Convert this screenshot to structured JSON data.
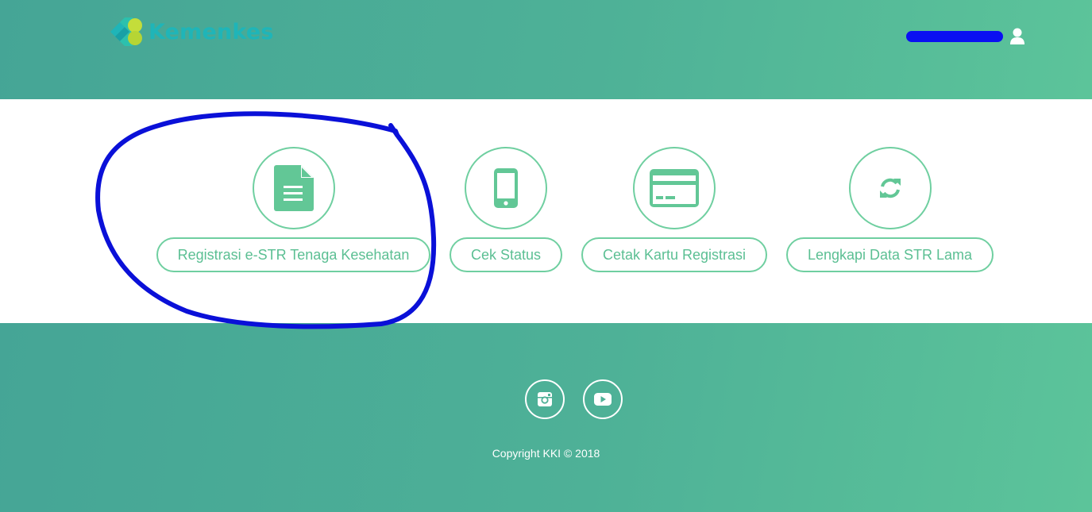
{
  "header": {
    "logo_text": "Kemenkes",
    "user_name": "██████████"
  },
  "menu": {
    "items": [
      {
        "label": "Registrasi e-STR Tenaga Kesehatan",
        "icon": "document-icon"
      },
      {
        "label": "Cek Status",
        "icon": "mobile-phone-icon"
      },
      {
        "label": "Cetak Kartu Registrasi",
        "icon": "credit-card-icon"
      },
      {
        "label": "Lengkapi Data STR Lama",
        "icon": "refresh-icon"
      }
    ]
  },
  "footer": {
    "social": [
      {
        "name": "instagram-icon"
      },
      {
        "name": "youtube-icon"
      }
    ],
    "copyright": "Copyright KKI © 2018"
  },
  "colors": {
    "accent": "#6fcfa0",
    "header_start": "#45a596",
    "header_end": "#5cc49a",
    "annotation": "#0a10d8"
  }
}
